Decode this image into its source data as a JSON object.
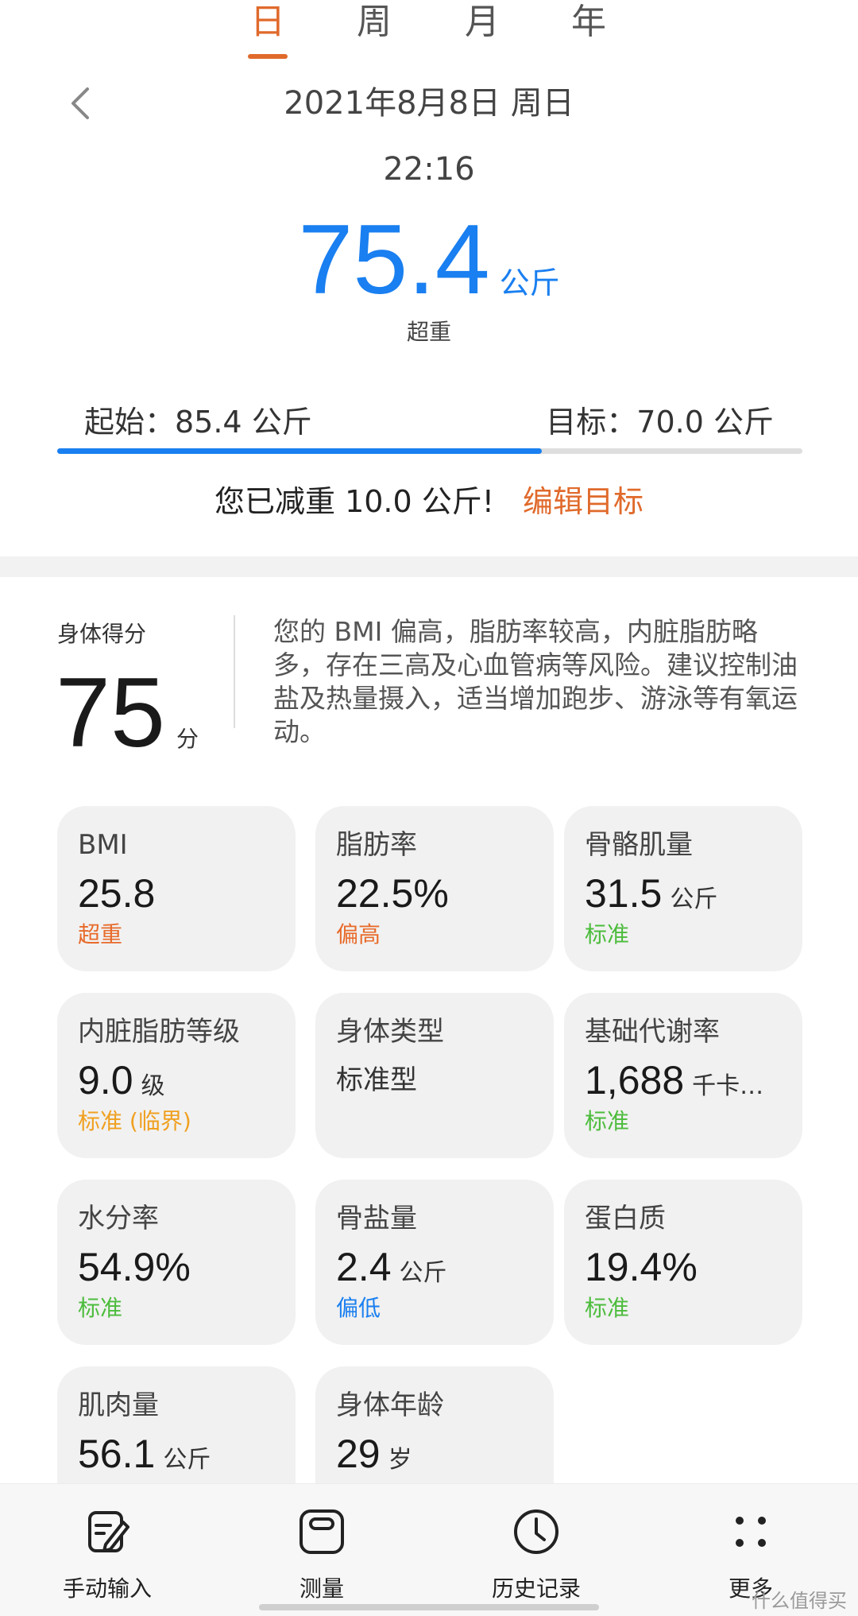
{
  "tabs": [
    {
      "label": "日",
      "active": true
    },
    {
      "label": "周",
      "active": false
    },
    {
      "label": "月",
      "active": false
    },
    {
      "label": "年",
      "active": false
    }
  ],
  "header": {
    "back_icon": "chevron-left-icon",
    "date": "2021年8月8日 周日",
    "time": "22:16"
  },
  "weight": {
    "value": "75.4",
    "unit": "公斤",
    "status": "超重"
  },
  "progress": {
    "start_label": "起始：85.4 公斤",
    "goal_label": "目标：70.0 公斤",
    "fraction": 0.65,
    "lost_text": "您已减重 10.0 公斤!",
    "edit_goal_label": "编辑目标"
  },
  "score": {
    "label": "身体得分",
    "value": "75",
    "unit": "分",
    "advice": "您的 BMI 偏高，脂肪率较高，内脏脂肪略多，存在三高及心血管病等风险。建议控制油盐及热量摄入，适当增加跑步、游泳等有氧运动。"
  },
  "metrics": [
    {
      "title": "BMI",
      "value": "25.8",
      "unit": "",
      "status": "超重",
      "status_color": "#e86a2a"
    },
    {
      "title": "脂肪率",
      "value": "22.5%",
      "unit": "",
      "status": "偏高",
      "status_color": "#e86a2a"
    },
    {
      "title": "骨骼肌量",
      "value": "31.5",
      "unit": "公斤",
      "status": "标准",
      "status_color": "#4cbc3c"
    },
    {
      "title": "内脏脂肪等级",
      "value": "9.0",
      "unit": "级",
      "status": "标准 (临界)",
      "status_color": "#f0a020"
    },
    {
      "title": "身体类型",
      "value": "",
      "text_value": "标准型",
      "unit": "",
      "status": "",
      "status_color": ""
    },
    {
      "title": "基础代谢率",
      "value": "1,688",
      "unit": "千卡…",
      "status": "标准",
      "status_color": "#4cbc3c"
    },
    {
      "title": "水分率",
      "value": "54.9%",
      "unit": "",
      "status": "标准",
      "status_color": "#4cbc3c"
    },
    {
      "title": "骨盐量",
      "value": "2.4",
      "unit": "公斤",
      "status": "偏低",
      "status_color": "#1a7ff0"
    },
    {
      "title": "蛋白质",
      "value": "19.4%",
      "unit": "",
      "status": "标准",
      "status_color": "#4cbc3c"
    },
    {
      "title": "肌肉量",
      "value": "56.1",
      "unit": "公斤",
      "status": "",
      "status_color": ""
    },
    {
      "title": "身体年龄",
      "value": "29",
      "unit": "岁",
      "status": "",
      "status_color": ""
    }
  ],
  "bottom_nav": [
    {
      "label": "手动输入",
      "icon": "edit-note-icon"
    },
    {
      "label": "测量",
      "icon": "scale-icon"
    },
    {
      "label": "历史记录",
      "icon": "clock-icon"
    },
    {
      "label": "更多",
      "icon": "more-dots-icon"
    }
  ],
  "watermark": "什么值得买",
  "colors": {
    "accent_blue": "#1a7ff0",
    "accent_orange": "#e06a2c"
  }
}
